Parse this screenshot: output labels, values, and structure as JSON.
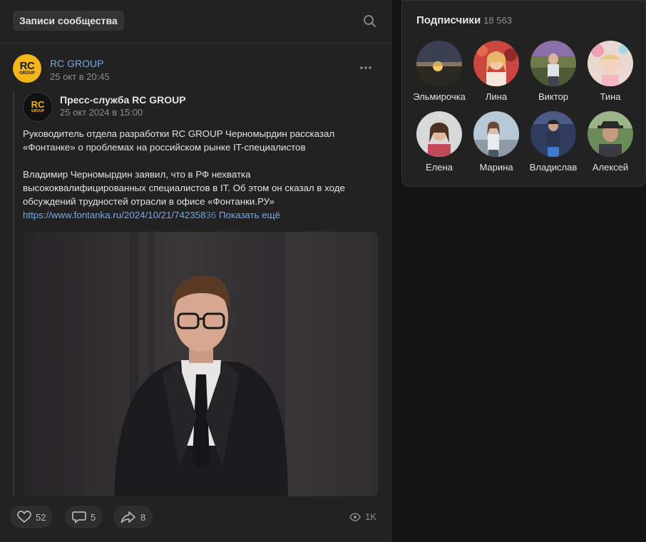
{
  "feed": {
    "tab_label": "Записи сообщества",
    "post": {
      "author": "RC GROUP",
      "date": "25 окт в 20:45",
      "avatar_text": "RC",
      "avatar_sub": "GROUP",
      "repost": {
        "author": "Пресс-служба RC GROUP",
        "date": "25 окт 2024 в 15:00",
        "paragraph1_line1": "Руководитель отдела разработки RC GROUP Черномырдин рассказал",
        "paragraph1_line2": "«Фонтанке» о проблемах на российском рынке IT-специалистов",
        "paragraph2_line1": "Владимир Черномырдин заявил, что в РФ нехватка",
        "paragraph2_line2": "высококвалифицированных специалистов в IT. Об этом он сказал в ходе",
        "paragraph2_line3": "обсуждений трудностей отрасли в офисе «Фонтанки.РУ»",
        "link": "https://www.fontanka.ru/2024/10/21/742358",
        "link_fade": "36",
        "show_more": "Показать ещё"
      },
      "likes": "52",
      "comments": "5",
      "shares": "8",
      "views": "1K"
    }
  },
  "subscribers": {
    "title": "Подписчики",
    "count": "18 563",
    "items": [
      {
        "name": "Эльмирочка"
      },
      {
        "name": "Лина"
      },
      {
        "name": "Виктор"
      },
      {
        "name": "Тина"
      },
      {
        "name": "Елена"
      },
      {
        "name": "Марина"
      },
      {
        "name": "Владислав"
      },
      {
        "name": "Алексей"
      }
    ]
  },
  "colors": {
    "accent": "#71aaeb",
    "brand_yellow": "#f2b51b",
    "panel": "#222222",
    "background": "#141414"
  }
}
